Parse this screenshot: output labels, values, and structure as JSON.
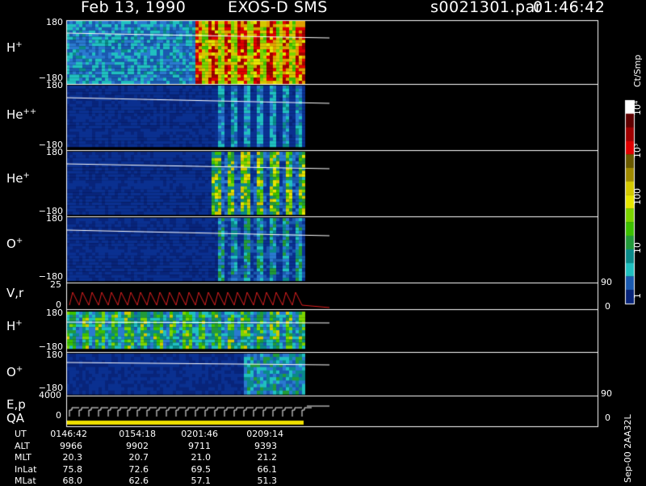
{
  "header": {
    "date": "Feb 13, 1990",
    "instrument": "EXOS-D SMS",
    "file": "s0021301.par",
    "time": "01:46:42"
  },
  "panels": [
    {
      "id": "h1",
      "label": "H",
      "charge": "+",
      "ytop": "180",
      "ybot": "−180"
    },
    {
      "id": "he2",
      "label": "He",
      "charge": "++",
      "ytop": "180",
      "ybot": "−180"
    },
    {
      "id": "he1",
      "label": "He",
      "charge": "+",
      "ytop": "180",
      "ybot": "−180"
    },
    {
      "id": "o1",
      "label": "O",
      "charge": "+",
      "ytop": "180",
      "ybot": "−180"
    },
    {
      "id": "vr",
      "label": "V,r",
      "charge": "",
      "ytop": "25",
      "ybot": "0"
    },
    {
      "id": "h2",
      "label": "H",
      "charge": "+",
      "ytop": "180",
      "ybot": "−180"
    },
    {
      "id": "o2",
      "label": "O",
      "charge": "+",
      "ytop": "180",
      "ybot": "−180"
    },
    {
      "id": "ep",
      "label": "E,p",
      "charge": "",
      "ytop": "4000",
      "ybot": "0"
    }
  ],
  "qa_label": "QA",
  "right_axes": {
    "vr": {
      "top": "90",
      "bot": "0"
    },
    "ep": {
      "top": "90",
      "bot": "0"
    }
  },
  "colorbar": {
    "title": "Ct/Smp",
    "labels": [
      "10⁴",
      "10³",
      "100",
      "10",
      "1"
    ],
    "colors": [
      "#ffffff",
      "#600000",
      "#a00000",
      "#e00000",
      "#6a5a00",
      "#a08a00",
      "#d4c800",
      "#e6e600",
      "#7cd400",
      "#3cc000",
      "#229a3a",
      "#0a8a8a",
      "#20c0c0",
      "#1a5ab0",
      "#08247a"
    ]
  },
  "footer": {
    "rows": [
      {
        "label": "UT",
        "values": [
          "0146:42",
          "0154:18",
          "0201:46",
          "0209:14"
        ]
      },
      {
        "label": "ALT",
        "values": [
          "9966",
          "9902",
          "9711",
          "9393"
        ]
      },
      {
        "label": "MLT",
        "values": [
          "20.3",
          "20.7",
          "21.0",
          "21.2"
        ]
      },
      {
        "label": "InLat",
        "values": [
          "75.8",
          "72.6",
          "69.5",
          "66.1"
        ]
      },
      {
        "label": "MLat",
        "values": [
          "68.0",
          "62.6",
          "57.1",
          "51.3"
        ]
      }
    ],
    "stamp": "Sep-00 2AA32L"
  },
  "chart_data": {
    "type": "heatmap",
    "title": "Feb 13, 1990   EXOS-D SMS",
    "x_ticks": [
      "0146:42",
      "0154:18",
      "0201:46",
      "0209:14"
    ],
    "panels": [
      "H+",
      "He++",
      "He+",
      "O+",
      "V,r",
      "H+",
      "O+",
      "E,p"
    ],
    "colorbar_units": "Ct/Smp",
    "colorbar_scale": "log",
    "colorbar_range": [
      1,
      10000
    ]
  }
}
